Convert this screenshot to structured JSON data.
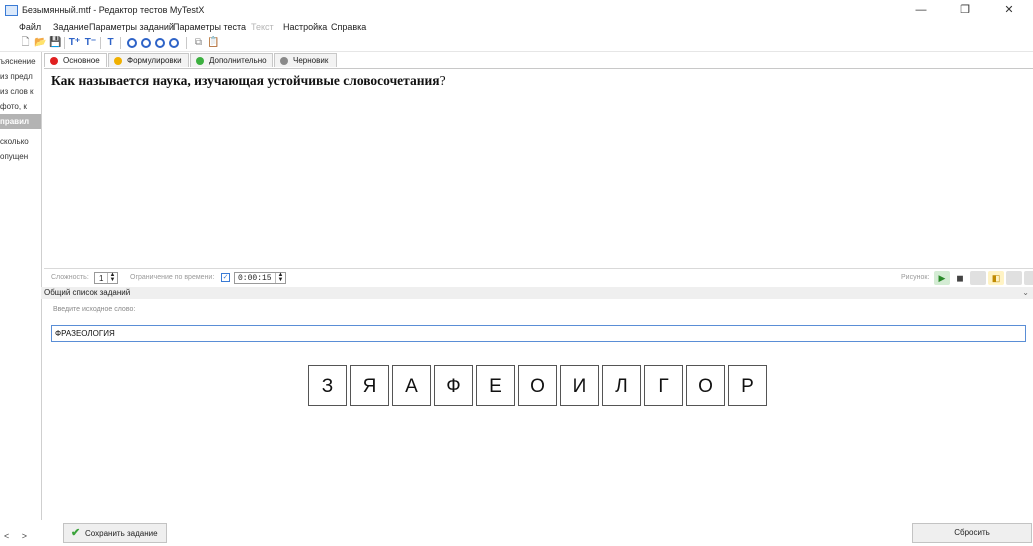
{
  "window": {
    "title": "Безымянный.mtf - Редактор тестов MyTestX",
    "minimize": "—",
    "maximize": "❐",
    "close": "✕"
  },
  "menu": {
    "items": [
      "Файл",
      "Задание",
      "Параметры заданий",
      "Параметры теста",
      "Текст",
      "Настройка",
      "Справка"
    ]
  },
  "left_list": {
    "items": [
      "ъяснение",
      "из предл",
      "из слов к",
      "фото, к",
      "правил",
      "сколько",
      "опущен",
      "",
      ""
    ],
    "scroll_left": "<",
    "scroll_right": ">"
  },
  "tabs": [
    {
      "label": "Основное",
      "color": "#e02020"
    },
    {
      "label": "Формулировки",
      "color": "#f0b000"
    },
    {
      "label": "Дополнительно",
      "color": "#3cb040"
    },
    {
      "label": "Черновик",
      "color": "#8a8a8a"
    }
  ],
  "question": {
    "text": "Как называется наука, изучающая устойчивые словосочетания",
    "mark": "?"
  },
  "props": {
    "difficulty_label": "Сложность:",
    "difficulty_value": "1",
    "timelimit_label": "Ограничение по времени:",
    "time_value": "0:00:15",
    "time_checked": true,
    "picture_label": "Рисунок:"
  },
  "list_header": "Общий список заданий",
  "task": {
    "hint": "Введите исходное слово:",
    "word": "ФРАЗЕОЛОГИЯ",
    "letters": [
      "З",
      "Я",
      "А",
      "Ф",
      "Е",
      "О",
      "И",
      "Л",
      "Г",
      "О",
      "Р"
    ]
  },
  "buttons": {
    "save": "Сохранить задание",
    "reset": "Сбросить"
  },
  "colors": {
    "selection_gray": "#b3b3b3",
    "input_border": "#5a8ed6",
    "save_check": "#3ba33b"
  }
}
